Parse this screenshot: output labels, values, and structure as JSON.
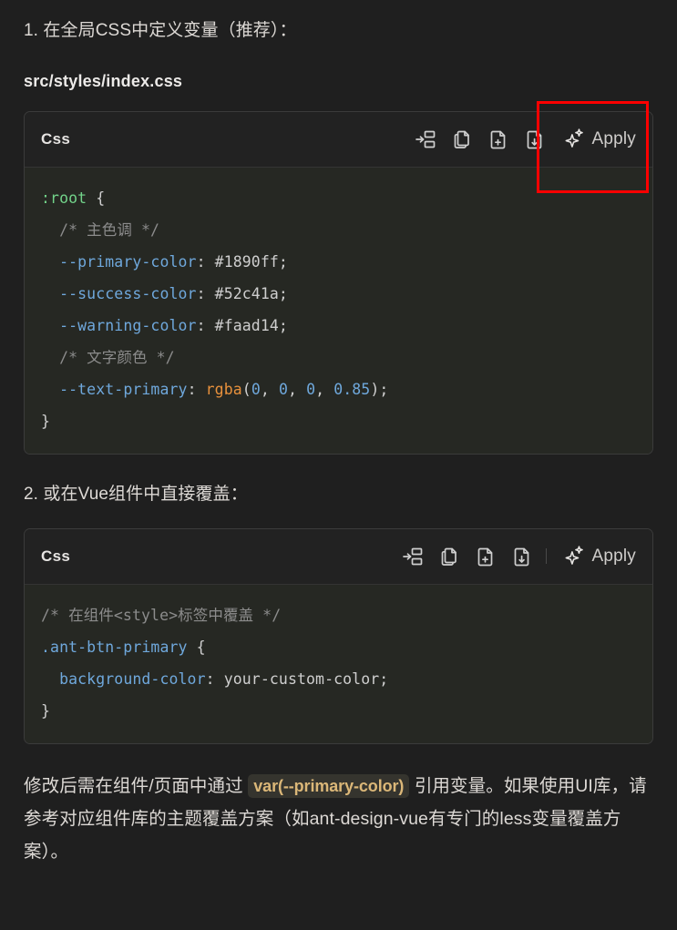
{
  "theme": {
    "background": "#1f1f1f",
    "code_background": "#262823",
    "code_header_background": "#222222",
    "border": "#3b3b3b",
    "text": "#ddd9d5",
    "inline_code_text": "#dbb778",
    "inline_code_background": "#35342e",
    "highlight_box": "#fe0000"
  },
  "step1": {
    "text": "1. 在全局CSS中定义变量（推荐）：",
    "filename": "src/styles/index.css"
  },
  "step2": {
    "text": "2. 或在Vue组件中直接覆盖："
  },
  "code_block_1": {
    "language_label": "Css",
    "actions": {
      "insert_at_cursor": "insert-at-cursor-icon",
      "copy": "copy-icon",
      "new_file": "new-file-icon",
      "save_to_file": "save-to-file-icon",
      "apply_label": "Apply",
      "apply_icon": "sparkle-icon"
    },
    "lines": [
      {
        "indent": 0,
        "tokens": [
          {
            "t": "sel",
            "v": ":root"
          },
          {
            "t": "punc",
            "v": " {"
          }
        ]
      },
      {
        "indent": 1,
        "tokens": [
          {
            "t": "com",
            "v": "/* 主色调 */"
          }
        ]
      },
      {
        "indent": 1,
        "tokens": [
          {
            "t": "prop",
            "v": "--primary-color"
          },
          {
            "t": "punc",
            "v": ": "
          },
          {
            "t": "val",
            "v": "#1890ff;"
          }
        ]
      },
      {
        "indent": 1,
        "tokens": [
          {
            "t": "prop",
            "v": "--success-color"
          },
          {
            "t": "punc",
            "v": ": "
          },
          {
            "t": "val",
            "v": "#52c41a;"
          }
        ]
      },
      {
        "indent": 1,
        "tokens": [
          {
            "t": "prop",
            "v": "--warning-color"
          },
          {
            "t": "punc",
            "v": ": "
          },
          {
            "t": "val",
            "v": "#faad14;"
          }
        ]
      },
      {
        "indent": 1,
        "tokens": [
          {
            "t": "com",
            "v": "/* 文字颜色 */"
          }
        ]
      },
      {
        "indent": 1,
        "tokens": [
          {
            "t": "prop",
            "v": "--text-primary"
          },
          {
            "t": "punc",
            "v": ": "
          },
          {
            "t": "fn",
            "v": "rgba"
          },
          {
            "t": "punc",
            "v": "("
          },
          {
            "t": "num",
            "v": "0"
          },
          {
            "t": "punc",
            "v": ", "
          },
          {
            "t": "num",
            "v": "0"
          },
          {
            "t": "punc",
            "v": ", "
          },
          {
            "t": "num",
            "v": "0"
          },
          {
            "t": "punc",
            "v": ", "
          },
          {
            "t": "num",
            "v": "0.85"
          },
          {
            "t": "punc",
            "v": ");"
          }
        ]
      },
      {
        "indent": 0,
        "tokens": [
          {
            "t": "punc",
            "v": "}"
          }
        ]
      }
    ],
    "raw": ":root {\n  /* 主色调 */\n  --primary-color: #1890ff;\n  --success-color: #52c41a;\n  --warning-color: #faad14;\n  /* 文字颜色 */\n  --text-primary: rgba(0, 0, 0, 0.85);\n}"
  },
  "code_block_2": {
    "language_label": "Css",
    "actions": {
      "insert_at_cursor": "insert-at-cursor-icon",
      "copy": "copy-icon",
      "new_file": "new-file-icon",
      "save_to_file": "save-to-file-icon",
      "separator": "|",
      "apply_label": "Apply",
      "apply_icon": "sparkle-icon"
    },
    "lines": [
      {
        "indent": 0,
        "tokens": [
          {
            "t": "com",
            "v": "/* 在组件<style>标签中覆盖 */"
          }
        ]
      },
      {
        "indent": 0,
        "tokens": [
          {
            "t": "class",
            "v": ".ant-btn-primary"
          },
          {
            "t": "punc",
            "v": " {"
          }
        ]
      },
      {
        "indent": 1,
        "tokens": [
          {
            "t": "prop",
            "v": "background-color"
          },
          {
            "t": "punc",
            "v": ": "
          },
          {
            "t": "val",
            "v": "your-custom-color;"
          }
        ]
      },
      {
        "indent": 0,
        "tokens": [
          {
            "t": "punc",
            "v": "}"
          }
        ]
      }
    ],
    "raw": "/* 在组件<style>标签中覆盖 */\n.ant-btn-primary {\n  background-color: your-custom-color;\n}"
  },
  "note": {
    "part1": "修改后需在组件/页面中通过 ",
    "inline_code": "var(--primary-color)",
    "part2": " 引用变量。如果使用UI库，请参考对应组件库的主题覆盖方案（如ant-design-vue有专门的less变量覆盖方案）。"
  },
  "annotation": {
    "highlight_target": "apply-button-code-block-1",
    "color": "#fe0000"
  }
}
